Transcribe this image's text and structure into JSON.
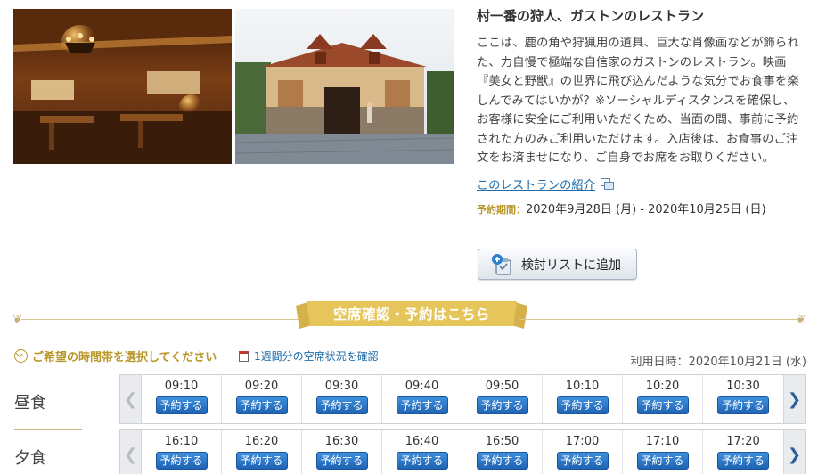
{
  "restaurant": {
    "title": "村一番の狩人、ガストンのレストラン",
    "description": "ここは、鹿の角や狩猟用の道具、巨大な肖像画などが飾られた、力自慢で極端な自信家のガストンのレストラン。映画『美女と野獣』の世界に飛び込んだような気分でお食事を楽しんでみてはいかが？※ソーシャルディスタンスを確保し、お客様に安全にご利用いただくため、当面の間、事前に予約された方のみご利用いただけます。入店後は、お食事のご注文をお済ませになり、ご自身でお席をお取りください。",
    "intro_link": "このレストランの紹介",
    "period_label": "予約期間：",
    "period_value": "2020年9月28日 (月) - 2020年10月25日 (日)",
    "add_list_button": "検討リストに追加"
  },
  "photos": [
    {
      "name": "interior-photo"
    },
    {
      "name": "exterior-photo"
    }
  ],
  "banner": {
    "text": "空席確認・予約はこちら"
  },
  "selection": {
    "prompt": "ご希望の時間帯を選択してください",
    "week_link": "1週間分の空席状況を確認",
    "use_date": "利用日時：2020年10月21日 (水)"
  },
  "meals": {
    "lunch": {
      "label": "昼食",
      "times": [
        "09:10",
        "09:20",
        "09:30",
        "09:40",
        "09:50",
        "10:10",
        "10:20",
        "10:30"
      ]
    },
    "dinner": {
      "label": "夕食",
      "times": [
        "16:10",
        "16:20",
        "16:30",
        "16:40",
        "16:50",
        "17:00",
        "17:10",
        "17:20"
      ]
    },
    "reserve_label": "予約する"
  },
  "colors": {
    "accent_gold": "#b8962a",
    "link_blue": "#1f6ca8",
    "button_blue": "#1f63b5",
    "ribbon_gold": "#e6c65a"
  },
  "icons": [
    "external-window-icon",
    "checklist-add-icon",
    "clock-icon",
    "calendar-icon",
    "chevron-left-icon",
    "chevron-right-icon"
  ]
}
